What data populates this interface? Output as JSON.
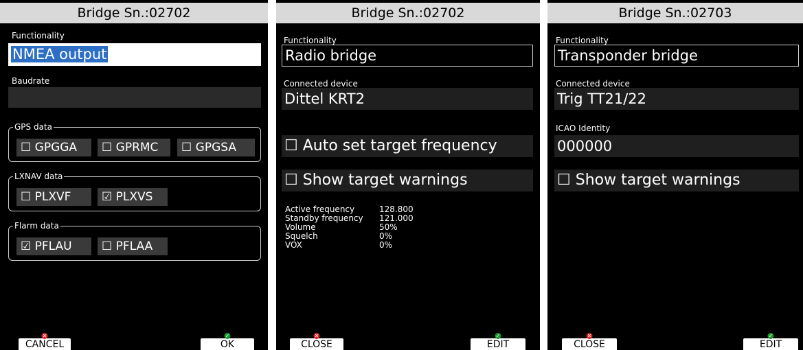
{
  "screen1": {
    "title": "Bridge Sn.:02702",
    "functionality_label": "Functionality",
    "functionality_value": "NMEA output",
    "baudrate_label": "Baudrate",
    "baudrate_value": "",
    "gps_group": {
      "label": "GPS data",
      "items": [
        {
          "box": "☐",
          "label": "GPGGA"
        },
        {
          "box": "☐",
          "label": "GPRMC"
        },
        {
          "box": "☐",
          "label": "GPGSA"
        }
      ]
    },
    "lxnav_group": {
      "label": "LXNAV data",
      "items": [
        {
          "box": "☐",
          "label": "PLXVF"
        },
        {
          "box": "☑",
          "label": "PLXVS"
        }
      ]
    },
    "flarm_group": {
      "label": "Flarm data",
      "items": [
        {
          "box": "☑",
          "label": "PFLAU"
        },
        {
          "box": "☐",
          "label": "PFLAA"
        }
      ]
    },
    "left_button": "CANCEL",
    "right_button": "OK"
  },
  "screen2": {
    "title": "Bridge Sn.:02702",
    "functionality_label": "Functionality",
    "functionality_value": "Radio bridge",
    "device_label": "Connected device",
    "device_value": "Dittel KRT2",
    "auto_set": {
      "box": "☐",
      "label": "Auto set target frequency"
    },
    "show_warnings": {
      "box": "☐",
      "label": "Show target warnings"
    },
    "info": [
      {
        "label": "Active frequency",
        "value": "128.800"
      },
      {
        "label": "Standby frequency",
        "value": "121.000"
      },
      {
        "label": "Volume",
        "value": "50%"
      },
      {
        "label": "Squelch",
        "value": "0%"
      },
      {
        "label": "VOX",
        "value": "0%"
      }
    ],
    "left_button": "CLOSE",
    "right_button": "EDIT"
  },
  "screen3": {
    "title": "Bridge Sn.:02703",
    "functionality_label": "Functionality",
    "functionality_value": "Transponder bridge",
    "device_label": "Connected device",
    "device_value": "Trig TT21/22",
    "icao_label": "ICAO Identity",
    "icao_value": "000000",
    "show_warnings": {
      "box": "☐",
      "label": "Show target warnings"
    },
    "left_button": "CLOSE",
    "right_button": "EDIT"
  },
  "colors": {
    "accent_select": "#2c6fc4",
    "cancel_mark": "#d22222",
    "ok_mark": "#1a9a2a"
  }
}
